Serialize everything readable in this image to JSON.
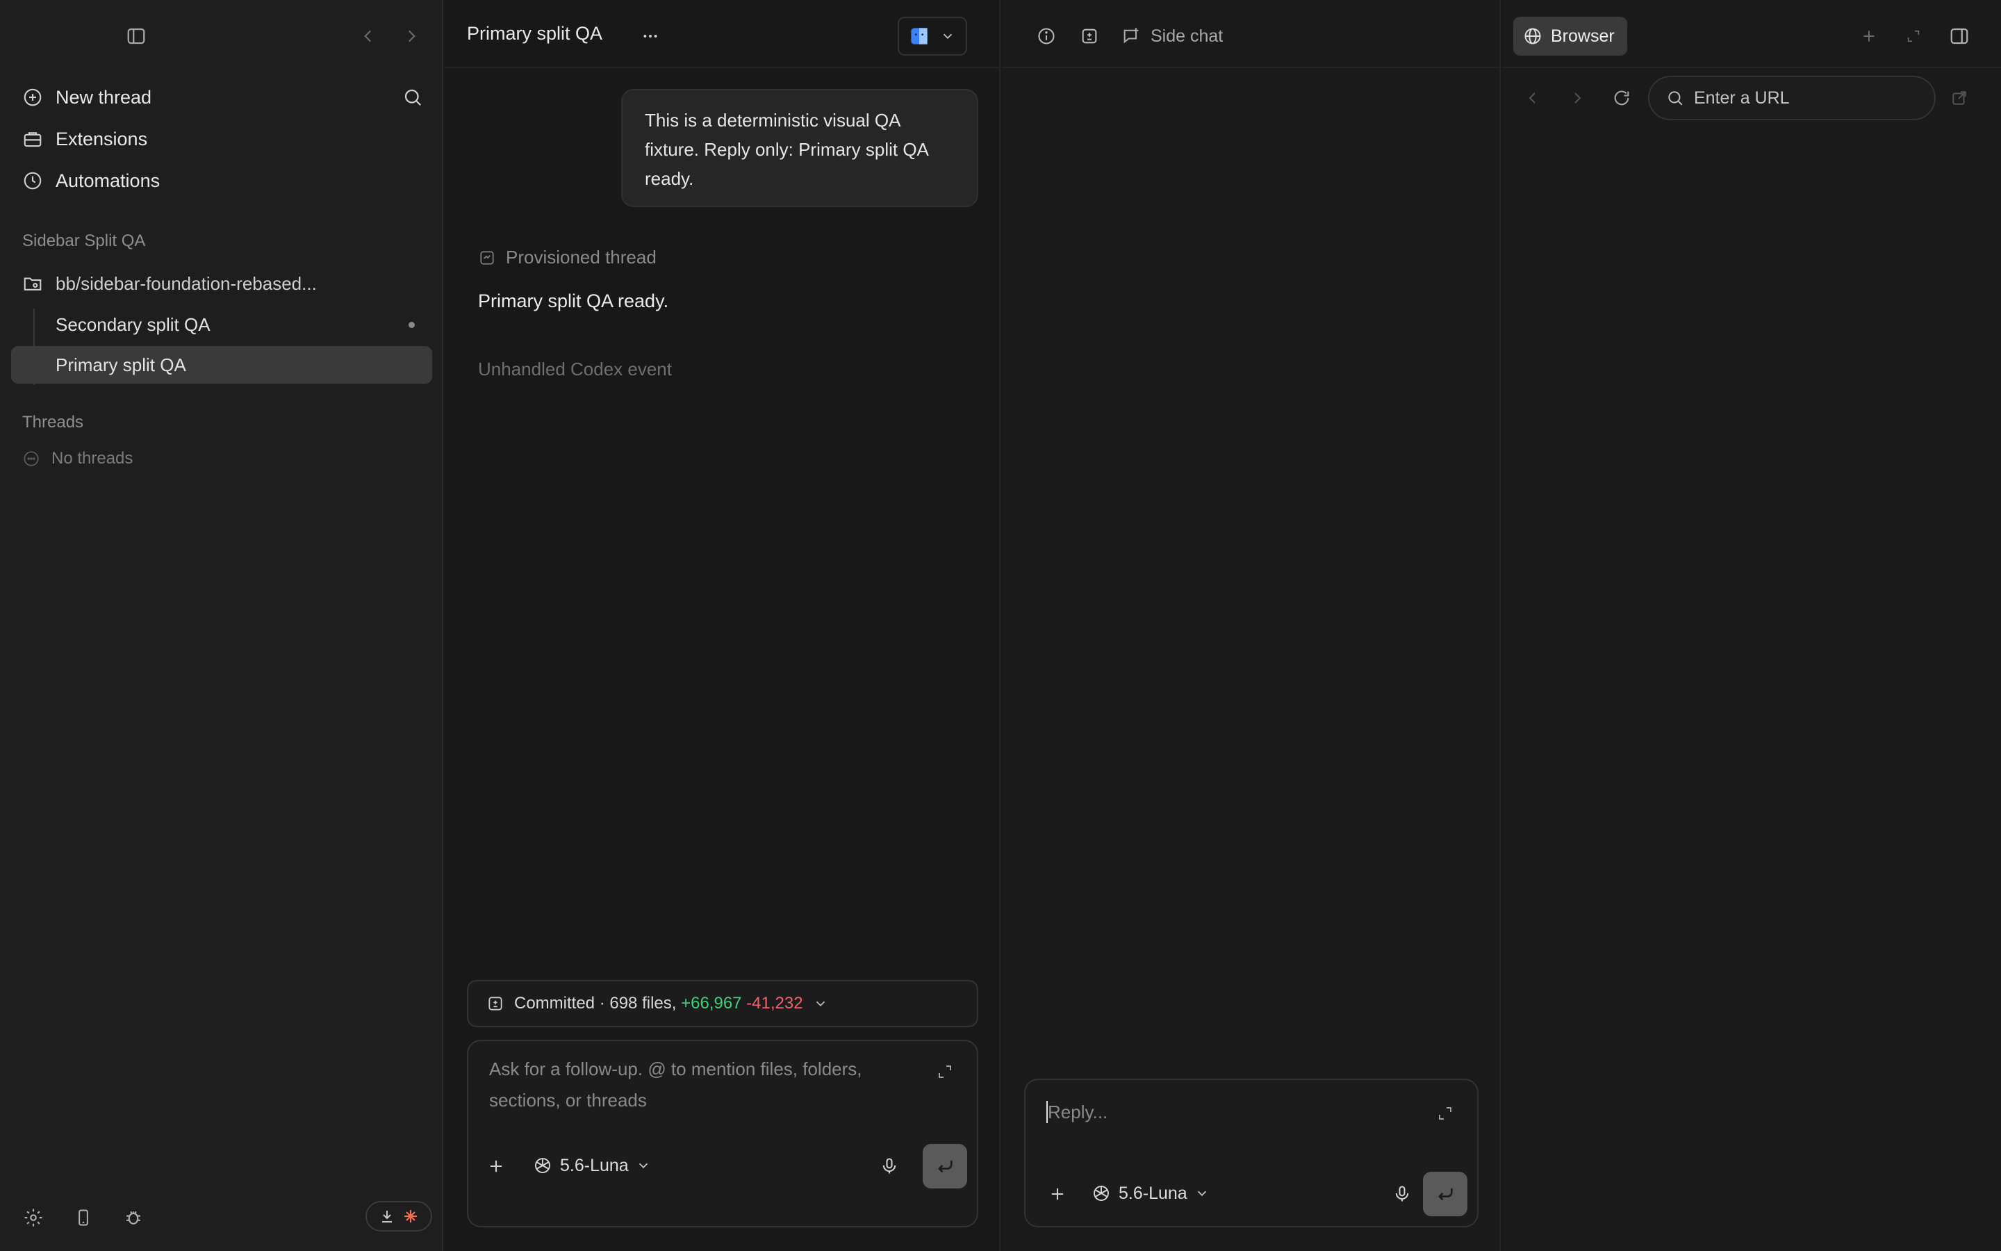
{
  "sidebar": {
    "nav": {
      "new_thread": "New thread",
      "extensions": "Extensions",
      "automations": "Automations"
    },
    "project_section_label": "Sidebar Split QA",
    "branch": "bb/sidebar-foundation-rebased...",
    "threads_in_project": [
      {
        "label": "Secondary split QA",
        "active": false,
        "unread": true
      },
      {
        "label": "Primary split QA",
        "active": true,
        "unread": false
      }
    ],
    "threads_section_label": "Threads",
    "no_threads": "No threads"
  },
  "chat": {
    "title": "Primary split QA",
    "user_message": "This is a deterministic visual QA fixture. Reply only: Primary split QA ready.",
    "provisioned_label": "Provisioned thread",
    "assistant_reply": "Primary split QA ready.",
    "unhandled_event": "Unhandled Codex event",
    "commit": {
      "prefix": "Committed · 698 files,",
      "additions": "+66,967",
      "deletions": "-41,232"
    },
    "composer": {
      "placeholder": "Ask for a follow-up. @ to mention files, folders, sections, or threads",
      "model": "5.6-Luna"
    }
  },
  "side_chat": {
    "label": "Side chat",
    "composer": {
      "placeholder": "Reply...",
      "model": "5.6-Luna"
    }
  },
  "browser": {
    "tab_label": "Browser",
    "url_placeholder": "Enter a URL"
  },
  "colors": {
    "additions": "#3fcf7a",
    "deletions": "#f0616d",
    "active_row": "#3a3a3a"
  }
}
